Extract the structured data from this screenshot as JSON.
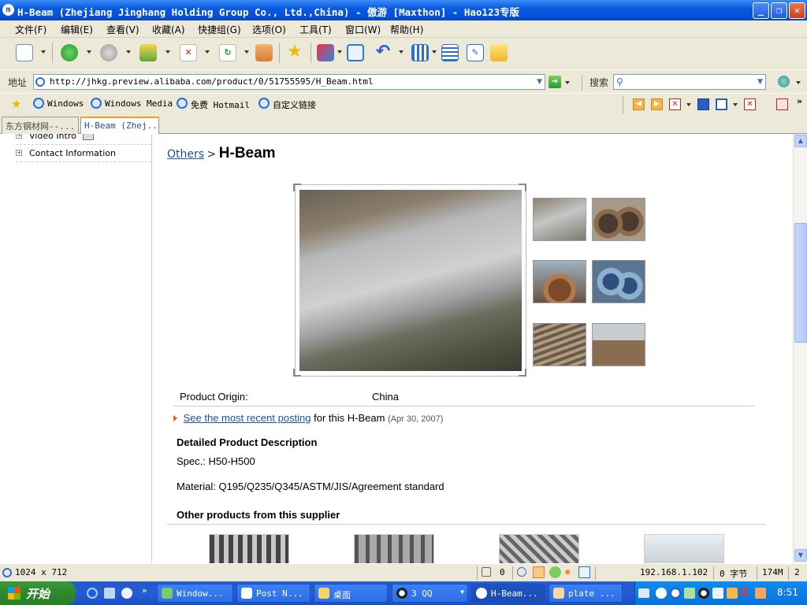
{
  "window": {
    "title": "H-Beam (Zhejiang Jinghang Holding Group Co., Ltd.,China) - 傲游 [Maxthon] - Hao123专版"
  },
  "menu": [
    "文件(F)",
    "编辑(E)",
    "查看(V)",
    "收藏(A)",
    "快捷组(G)",
    "选项(O)",
    "工具(T)",
    "窗口(W)",
    "帮助(H)"
  ],
  "address": {
    "label": "地址",
    "url": "http://jhkg.preview.alibaba.com/product/0/51755595/H_Beam.html",
    "search_label": "搜索",
    "search_value": ""
  },
  "links": [
    {
      "label": "Windows"
    },
    {
      "label": "Windows Media"
    },
    {
      "label": "免费 Hotmail"
    },
    {
      "label": "自定义链接"
    }
  ],
  "tabs": [
    {
      "label": "东方钢材网--..."
    },
    {
      "label": "H-Beam (Zhej..."
    }
  ],
  "sidebar": {
    "items": [
      {
        "label": "Video Intro"
      },
      {
        "label": "Contact Information"
      }
    ]
  },
  "page": {
    "breadcrumb": {
      "parent": "Others",
      "sep": ">",
      "current": "H-Beam"
    },
    "origin": {
      "label": "Product Origin:",
      "value": "China"
    },
    "posting": {
      "link": "See the most recent posting",
      "text": "for this H-Beam",
      "date": "(Apr 30, 2007)"
    },
    "detail": {
      "heading": "Detailed Product Description",
      "spec": "Spec.: H50-H500",
      "material": "Material: Q195/Q235/Q345/ASTM/JIS/Agreement standard"
    },
    "other": {
      "heading": "Other products from this supplier"
    }
  },
  "status": {
    "dimensions": "1024 x 712",
    "count": "0",
    "ip": "192.168.1.102",
    "bytes": "0 字节",
    "memory": "174M",
    "num": "2"
  },
  "taskbar": {
    "start": "开始",
    "tasks": [
      {
        "label": "Window..."
      },
      {
        "label": "Post N..."
      },
      {
        "label": "桌面"
      },
      {
        "label": "3 QQ"
      },
      {
        "label": "H-Beam..."
      },
      {
        "label": "plate ..."
      }
    ],
    "clock": "8:51"
  }
}
